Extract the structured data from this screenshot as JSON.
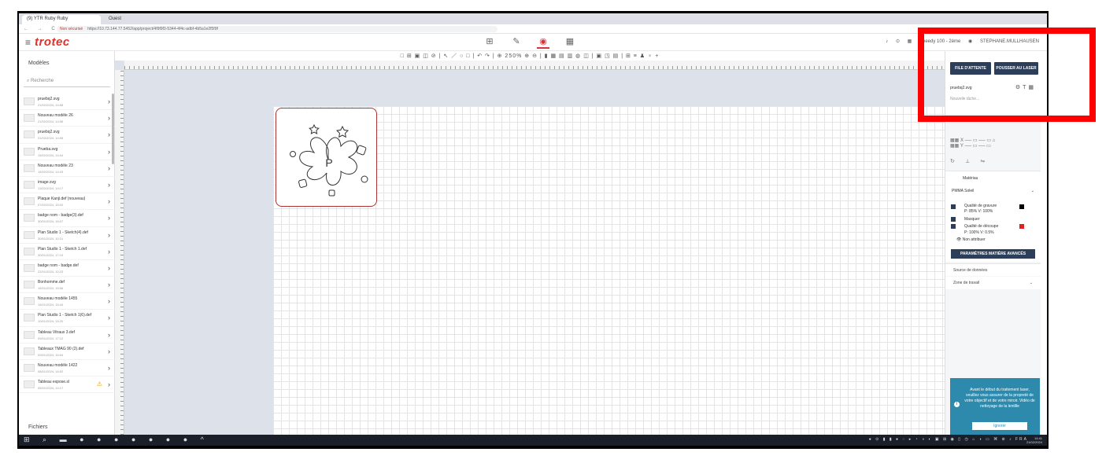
{
  "browser": {
    "tabs": [
      {
        "label": "(9) YTR Ruby Ruby",
        "active": true
      },
      {
        "label": "Ouest"
      }
    ],
    "nav_icons": "← → C",
    "secure_label": "Non sécurisé",
    "url": "https://10.73.144.77.5452/app/project/4f9f9f3-5344-4f4c-adbf-4b5a1e2f5f9f"
  },
  "header": {
    "logo": "trotec",
    "right_text": {
      "machine": "Speedy 100 - 2ème",
      "user": "STEPHANE.MULLHAUSEN"
    }
  },
  "left_panel": {
    "title": "Modèles",
    "search_placeholder": "Recherche",
    "footer": "Fichiers",
    "items": [
      {
        "name": "pruebq2.svg",
        "date": "21/02/2024, 14:58"
      },
      {
        "name": "Nouveau modèle 26",
        "date": "21/02/2024, 14:56"
      },
      {
        "name": "pruebq2.svg",
        "date": "21/02/2024, 14:55"
      },
      {
        "name": "Prueba.svg",
        "date": "15/02/2024, 14:44"
      },
      {
        "name": "Nouveau modèle 23",
        "date": "15/02/2024, 14:43"
      },
      {
        "name": "image.svg",
        "date": "13/02/2024, 14:17"
      },
      {
        "name": "Plaque Kanji.def (nouveau)",
        "date": "07/02/2024, 15:02"
      },
      {
        "name": "badge nom - badge(3).def",
        "date": "30/01/2024, 16:07"
      },
      {
        "name": "Plan Studio 1 - Sketch(4).def",
        "date": "30/01/2024, 10:31"
      },
      {
        "name": "Plan Studio 1 - Sketch 1.def",
        "date": "30/01/2024, 17:19"
      },
      {
        "name": "badge nom - badge.def",
        "date": "22/01/2024, 10:23"
      },
      {
        "name": "Bonhomme.def",
        "date": "15/01/2024, 15:56"
      },
      {
        "name": "Nouveau modèle 1455",
        "date": "15/01/2024, 15:44"
      },
      {
        "name": "Plan Studio 1 - Sketch 1(6).def",
        "date": "10/01/2024, 15:20"
      },
      {
        "name": "Tableau Vitraux 3.def",
        "date": "09/01/2024, 17:12"
      },
      {
        "name": "Tableaux TMAG 90 (2).def",
        "date": "09/01/2024, 16:54"
      },
      {
        "name": "Nouveau modèle 1422",
        "date": "08/01/2024, 16:52"
      },
      {
        "name": "Tableau expose.sl",
        "date": "05/01/2024, 14:17"
      }
    ]
  },
  "canvas": {
    "toolbar_text": "□ ⊞ ▣ ◫ ⊘  |  ↖ ／ ○ □  |  ↶ ↷  |  ⊕ 250% ⊕ ⊖  |  ▮ ▦ ▤ ▥ ◍ ◫  |  ▣ ◳ ▤  |  ⊞ ≡ ♟ ♀ +",
    "design_letter": "P"
  },
  "right_panel": {
    "queue_button": "FILE D'ATTENTE",
    "push_button": "POUSSER AU LASER",
    "file_name": "pruebq2.svg",
    "new_job_placeholder": "Nouvelle tâche...",
    "material_header": "Matériau",
    "material_name": "PMMA Soleil",
    "row1": "Qualité de gravure",
    "row1_params": "P: 85%   V: 100%",
    "row2": "Masquer",
    "row3": "Qualité de découpe",
    "row3_params": "P: 100%   V: 0.5%",
    "row4": "Non attribuer",
    "advanced_button": "PARAMÈTRES MATIÈRE AVANCÉS",
    "data_source": "Source de données",
    "work_zone": "Zone de travail",
    "notice": "Avant le début du traitement laser, veuillez vous assurer de la propreté de votre objectif et de votre miroir. Vidéo de nettoyage de la lentille",
    "ignore_button": "Ignorer"
  },
  "taskbar": {
    "icons": "⊞ ⌕ ▬ ● ● ● ● ● ● ● ^",
    "time": "14:41",
    "date": "21/02/2024"
  },
  "colors": {
    "brand_red": "#e0312b",
    "navy": "#2c3e5a",
    "notice_blue": "#2d8aad",
    "highlight": "#ff0000"
  }
}
